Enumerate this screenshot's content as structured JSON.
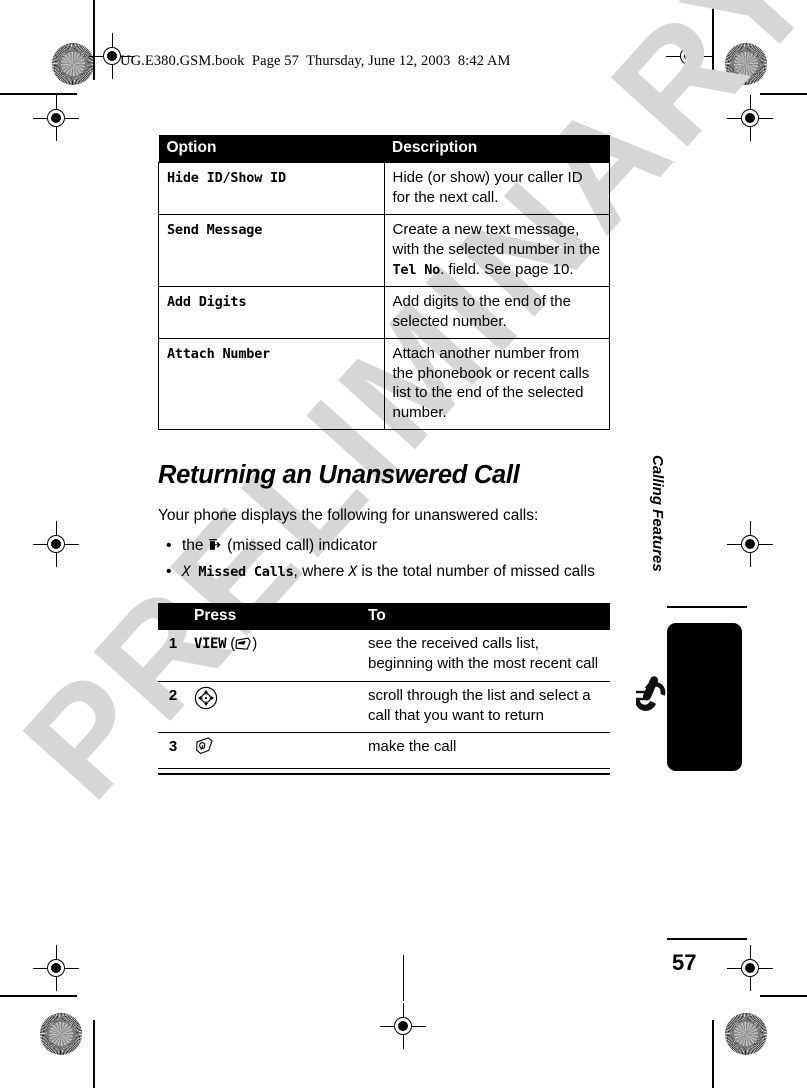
{
  "document": {
    "header_line": "UG.E380.GSM.book  Page 57  Thursday, June 12, 2003  8:42 AM",
    "watermark": "PRELIMINARY",
    "page_number": "57",
    "sidebar_label": "Calling Features"
  },
  "options_table": {
    "headers": [
      "Option",
      "Description"
    ],
    "rows": [
      {
        "option": "Hide ID/Show ID",
        "description_parts": [
          {
            "text": "Hide (or show) your caller ID for the next call.",
            "style": "normal"
          }
        ]
      },
      {
        "option": "Send Message",
        "description_parts": [
          {
            "text": "Create a new text message, with the selected number in the ",
            "style": "normal"
          },
          {
            "text": "Tel No",
            "style": "mono"
          },
          {
            "text": ". field. See page 10.",
            "style": "normal"
          }
        ]
      },
      {
        "option": "Add Digits",
        "description_parts": [
          {
            "text": "Add digits to the end of the selected number.",
            "style": "normal"
          }
        ]
      },
      {
        "option": "Attach Number",
        "description_parts": [
          {
            "text": "Attach another number from the phonebook or recent calls list to the end of the selected number.",
            "style": "normal"
          }
        ]
      }
    ]
  },
  "section": {
    "heading": "Returning an Unanswered Call",
    "intro": "Your phone displays the following for unanswered calls:",
    "bullets": [
      {
        "prefix": "the ",
        "icon": "missed-call-icon",
        "suffix": " (missed call) indicator"
      },
      {
        "var1": "X",
        "mono": " Missed Calls",
        "mid": ", where ",
        "var2": "X",
        "tail": " is the total number of missed calls"
      }
    ]
  },
  "steps_table": {
    "headers": [
      "",
      "Press",
      "To"
    ],
    "rows": [
      {
        "num": "1",
        "press_label": "VIEW",
        "press_icon": "softkey-icon",
        "press_open": " (",
        "press_close": ")",
        "to": "see the received calls list, beginning with the most recent call"
      },
      {
        "num": "2",
        "press_label": "",
        "press_icon": "navigation-key-icon",
        "press_open": "",
        "press_close": "",
        "to": "scroll through the list and select a call that you want to return"
      },
      {
        "num": "3",
        "press_label": "",
        "press_icon": "send-key-icon",
        "press_open": "",
        "press_close": "",
        "to": "make the call"
      }
    ]
  },
  "colors": {
    "header_bg": "#000000",
    "header_fg": "#ffffff",
    "watermark": "#d6d6d6",
    "page_bg": "#ffffff"
  }
}
